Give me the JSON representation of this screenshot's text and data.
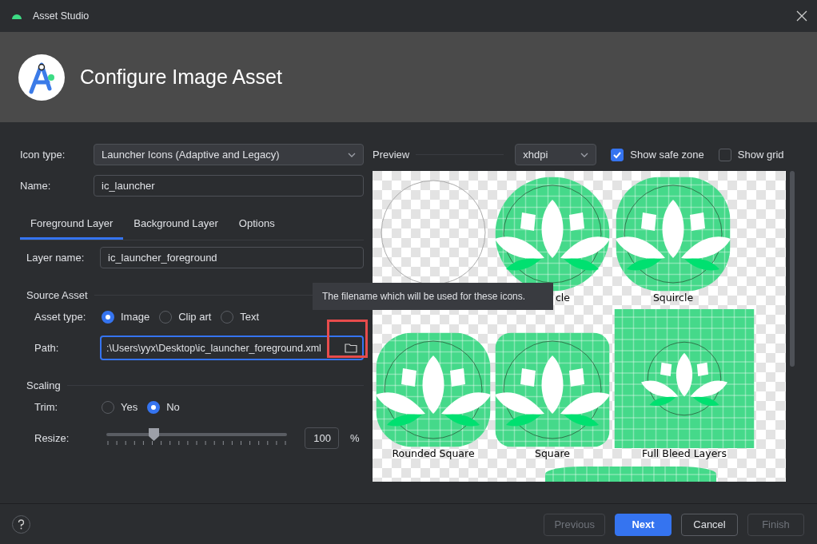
{
  "window": {
    "title": "Asset Studio"
  },
  "header": {
    "title": "Configure Image Asset"
  },
  "icon_type": {
    "label": "Icon type:",
    "value": "Launcher Icons (Adaptive and Legacy)"
  },
  "name": {
    "label": "Name:",
    "value": "ic_launcher"
  },
  "tabs": [
    {
      "label": "Foreground Layer",
      "selected": true
    },
    {
      "label": "Background Layer",
      "selected": false
    },
    {
      "label": "Options",
      "selected": false
    }
  ],
  "layer_name": {
    "label": "Layer name:",
    "value": "ic_launcher_foreground"
  },
  "source_asset": {
    "title": "Source Asset",
    "asset_type_label": "Asset type:",
    "asset_types": [
      {
        "label": "Image",
        "selected": true
      },
      {
        "label": "Clip art",
        "selected": false
      },
      {
        "label": "Text",
        "selected": false
      }
    ],
    "path": {
      "label": "Path:",
      "value": ":\\Users\\yyx\\Desktop\\ic_launcher_foreground.xml"
    }
  },
  "scaling": {
    "title": "Scaling",
    "trim_label": "Trim:",
    "trim_options": [
      {
        "label": "Yes",
        "selected": false
      },
      {
        "label": "No",
        "selected": true
      }
    ],
    "resize": {
      "label": "Resize:",
      "level": 0.26,
      "value": "100",
      "unit": "%"
    }
  },
  "preview": {
    "title": "Preview",
    "density": "xhdpi",
    "show_safe_zone": {
      "label": "Show safe zone",
      "checked": true
    },
    "show_grid": {
      "label": "Show grid",
      "checked": false
    },
    "shapes": [
      {
        "kind": "legacy"
      },
      {
        "kind": "circle",
        "label": "cle"
      },
      {
        "kind": "squircle",
        "label": "Squircle"
      },
      {
        "kind": "rounded",
        "label": "Rounded Square"
      },
      {
        "kind": "square",
        "label": "Square"
      },
      {
        "kind": "full_bleed",
        "label": "Full Bleed Layers"
      },
      {
        "kind": "partial"
      }
    ]
  },
  "tooltip": {
    "text": "The filename which will be used for these icons."
  },
  "buttons": [
    {
      "label": "Previous",
      "kind": "default",
      "disabled": true
    },
    {
      "label": "Next",
      "kind": "primary",
      "disabled": false
    },
    {
      "label": "Cancel",
      "kind": "default",
      "disabled": false
    },
    {
      "label": "Finish",
      "kind": "default",
      "disabled": true
    }
  ]
}
